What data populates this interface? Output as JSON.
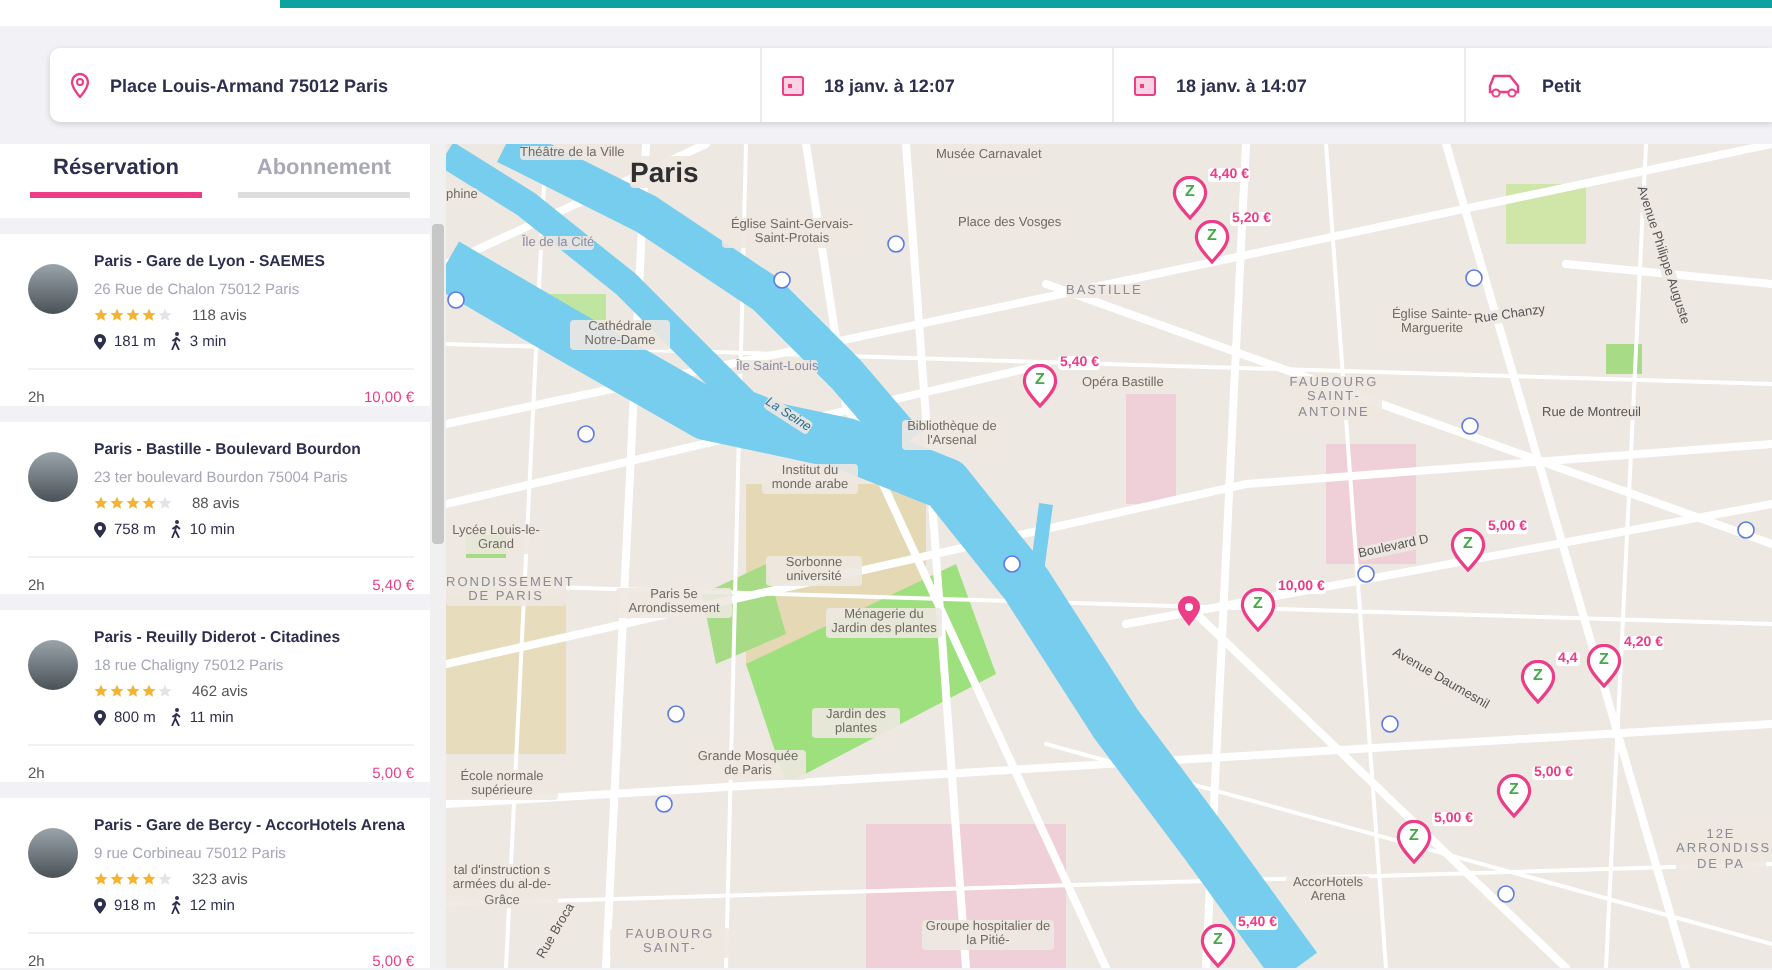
{
  "search_bar": {
    "location": "Place Louis-Armand 75012 Paris",
    "start": "18 janv. à 12:07",
    "end": "18 janv. à 14:07",
    "vehicle": "Petit"
  },
  "tabs": [
    {
      "label": "Réservation",
      "selected": true
    },
    {
      "label": "Abonnement",
      "selected": false
    }
  ],
  "stations": [
    {
      "name": "Paris - Gare de Lyon - SAEMES",
      "address": "26 Rue de Chalon 75012 Paris",
      "stars": 4,
      "reviews": "118 avis",
      "distance": "181 m",
      "walk": "3 min",
      "duration": "2h",
      "price": "10,00 €"
    },
    {
      "name": "Paris - Bastille - Boulevard Bourdon",
      "address": "23 ter boulevard Bourdon 75004 Paris",
      "stars": 4,
      "reviews": "88 avis",
      "distance": "758 m",
      "walk": "10 min",
      "duration": "2h",
      "price": "5,40 €"
    },
    {
      "name": "Paris - Reuilly Diderot - Citadines",
      "address": "18 rue Chaligny 75012 Paris",
      "stars": 4,
      "reviews": "462 avis",
      "distance": "800 m",
      "walk": "11 min",
      "duration": "2h",
      "price": "5,00 €"
    },
    {
      "name": "Paris - Gare de Bercy - AccorHotels Arena",
      "address": "9 rue Corbineau 75012 Paris",
      "stars": 4,
      "reviews": "323 avis",
      "distance": "918 m",
      "walk": "12 min",
      "duration": "2h",
      "price": "5,00 €"
    }
  ],
  "map": {
    "labels": [
      {
        "text": "Paris",
        "kind": "city"
      },
      {
        "text": "Théâtre de la Ville",
        "kind": "place"
      },
      {
        "text": "phine",
        "kind": "place"
      },
      {
        "text": "Musée Carnavalet",
        "kind": "place"
      },
      {
        "text": "Église Saint-Gervais-Saint-Protais",
        "kind": "place"
      },
      {
        "text": "Place des Vosges",
        "kind": "place"
      },
      {
        "text": "Île de la Cité",
        "kind": "island"
      },
      {
        "text": "Cathédrale Notre-Dame",
        "kind": "place"
      },
      {
        "text": "Île Saint-Louis",
        "kind": "island"
      },
      {
        "text": "La Seine",
        "kind": "water"
      },
      {
        "text": "Bibliothèque de l'Arsenal",
        "kind": "place"
      },
      {
        "text": "BASTILLE",
        "kind": "district"
      },
      {
        "text": "Opéra Bastille",
        "kind": "place"
      },
      {
        "text": "Institut du monde arabe",
        "kind": "place"
      },
      {
        "text": "Sorbonne université",
        "kind": "place"
      },
      {
        "text": "Lycée Louis-le-Grand",
        "kind": "place"
      },
      {
        "text": "RONDISSEMENT DE PARIS",
        "kind": "district"
      },
      {
        "text": "Paris 5e Arrondissement",
        "kind": "place"
      },
      {
        "text": "Ménagerie du Jardin des plantes",
        "kind": "place"
      },
      {
        "text": "Jardin des plantes",
        "kind": "place"
      },
      {
        "text": "Grande Mosquée de Paris",
        "kind": "place"
      },
      {
        "text": "École normale supérieure",
        "kind": "place"
      },
      {
        "text": "tal d'instruction s armées du al-de-Grâce",
        "kind": "place"
      },
      {
        "text": "Rue Broca",
        "kind": "street"
      },
      {
        "text": "FAUBOURG SAINT-",
        "kind": "district"
      },
      {
        "text": "Groupe hospitalier de la Pitié-",
        "kind": "place"
      },
      {
        "text": "Église Sainte-Marguerite",
        "kind": "place"
      },
      {
        "text": "Rue Chanzy",
        "kind": "street"
      },
      {
        "text": "FAUBOURG SAINT-ANTOINE",
        "kind": "district"
      },
      {
        "text": "Rue de Montreuil",
        "kind": "street"
      },
      {
        "text": "Avenue Philippe Auguste",
        "kind": "street"
      },
      {
        "text": "Boulevard D",
        "kind": "street"
      },
      {
        "text": "Avenue Daumesnil",
        "kind": "street"
      },
      {
        "text": "AccorHotels Arena",
        "kind": "place"
      },
      {
        "text": "12E ARRONDISS DE PA",
        "kind": "district"
      }
    ],
    "markers": [
      {
        "price": "4,40 €",
        "logo": "Z"
      },
      {
        "price": "5,20 €",
        "logo": "Z"
      },
      {
        "price": "5,40 €",
        "logo": "Z"
      },
      {
        "price": "10,00 €",
        "logo": "Z"
      },
      {
        "price": "5,00 €",
        "logo": "Z"
      },
      {
        "price": "4,4",
        "logo": "Z"
      },
      {
        "price": "4,20 €",
        "logo": "Z"
      },
      {
        "price": "5,00 €",
        "logo": "Z"
      },
      {
        "price": "5,00 €",
        "logo": "Z"
      },
      {
        "price": "5,40 €",
        "logo": "Z"
      }
    ]
  }
}
